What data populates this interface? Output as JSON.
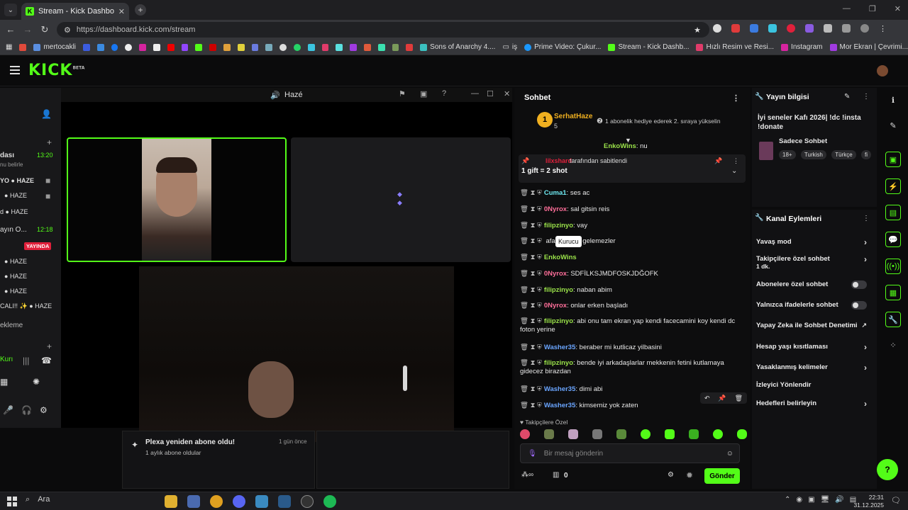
{
  "browser": {
    "tab_title": "Stream - Kick Dashboard",
    "url": "https://dashboard.kick.com/stream",
    "bookmarks": [
      "mertocakli",
      "Sons of Anarchy 4....",
      "iş",
      "Prime Video: Çukur...",
      "Stream - Kick Dashb...",
      "Hızlı Resim ve Resi...",
      "Instagram",
      "Mor Ekran | Çevrimi..."
    ]
  },
  "kick": {
    "logo": "KICK",
    "logo_sup": "BETA"
  },
  "left_panel": {
    "rows": [
      "dası",
      "nu belirle",
      "YO",
      "HAZE",
      "HAZE",
      "HAZE",
      "ayın O...",
      "YAYINDA",
      "HAZE",
      "HAZE",
      "HAZE",
      "HAZE",
      "CALI!!",
      "ekleme",
      "Kurı"
    ],
    "times": [
      "13:20",
      "12:18"
    ]
  },
  "video": {
    "title": "Hazé",
    "notif_title": "Plexa yeniden abone oldu!",
    "notif_sub": "1 aylık abone oldular",
    "notif_time": "1 gün önce"
  },
  "chat": {
    "header": "Sohbet",
    "top_user": "SerhatHaze",
    "top_count": "5",
    "top_msg": "1 abonelik hediye ederek 2. sıraya yükselin",
    "pinned_by_user": "lilxshard",
    "pinned_by_text": "tarafından sabitlendi",
    "pinned_msg": "1 gift = 2 shot",
    "peek_user": "EnkoWins",
    "tooltip": "Kurucu",
    "messages": [
      {
        "user": "Cuma1",
        "color": "#6ee8f0",
        "text": "ses ac"
      },
      {
        "user": "0Nyrox",
        "color": "#ff6f9a",
        "text": "sal gitsin reis"
      },
      {
        "user": "filipzinyo",
        "color": "#9be34a",
        "text": "vay"
      },
      {
        "user": "",
        "color": "#ddd",
        "text": "afalar güzel gelemezler"
      },
      {
        "user": "EnkoWins",
        "color": "#9be34a",
        "text": ""
      },
      {
        "user": "0Nyrox",
        "color": "#ff6f9a",
        "text": "SDFİLKSJMDFOSKJDĞOFK"
      },
      {
        "user": "filipzinyo",
        "color": "#9be34a",
        "text": "naban abim"
      },
      {
        "user": "0Nyrox",
        "color": "#ff6f9a",
        "text": "onlar erken başladı"
      },
      {
        "user": "filipzinyo",
        "color": "#9be34a",
        "text": "abi onu tam ekran yap kendi facecamini koy kendi dc foton yerine"
      },
      {
        "user": "Washer35",
        "color": "#6aa5ff",
        "text": "beraber mi kutlicaz yilbasini"
      },
      {
        "user": "filipzinyo",
        "color": "#9be34a",
        "text": "bende iyi arkadaşlarlar mekkenin fetini kutlamaya gidecez birazdan"
      },
      {
        "user": "Washer35",
        "color": "#6aa5ff",
        "text": "dimi abi"
      },
      {
        "user": "Washer35",
        "color": "#6aa5ff",
        "text": "kimsemiz yok zaten"
      }
    ],
    "followers_only": "Takipçilere Özel",
    "input_placeholder": "Bir mesaj gönderin",
    "send_label": "Gönder",
    "counter": "0"
  },
  "stream_info": {
    "header": "Yayın bilgisi",
    "title": "İyi seneler Kafı 2026| !dc !insta !donate",
    "category": "Sadece Sohbet",
    "tags": [
      "18+",
      "Turkish",
      "Türkçe",
      "fi"
    ]
  },
  "channel_actions": {
    "header": "Kanal Eylemleri",
    "items": [
      {
        "label": "Yavaş mod",
        "sub": "",
        "control": "chevron"
      },
      {
        "label": "Takipçilere özel sohbet",
        "sub": "1 dk.",
        "control": "chevron"
      },
      {
        "label": "Abonelere özel sohbet",
        "sub": "",
        "control": "toggle"
      },
      {
        "label": "Yalnızca ifadelerle sohbet",
        "sub": "",
        "control": "toggle"
      },
      {
        "label": "Yapay Zeka ile Sohbet Denetimi",
        "sub": "",
        "control": "external"
      },
      {
        "label": "Hesap yaşı kısıtlaması",
        "sub": "",
        "control": "chevron"
      },
      {
        "label": "Yasaklanmış kelimeler",
        "sub": "",
        "control": "chevron"
      },
      {
        "label": "İzleyici Yönlendir",
        "sub": "",
        "control": "none"
      },
      {
        "label": "Hedefleri belirleyin",
        "sub": "",
        "control": "chevron"
      }
    ]
  },
  "taskbar": {
    "search": "Ara",
    "time": "22:31",
    "date": "31.12.2025"
  },
  "colors": {
    "accent": "#53fc18"
  }
}
